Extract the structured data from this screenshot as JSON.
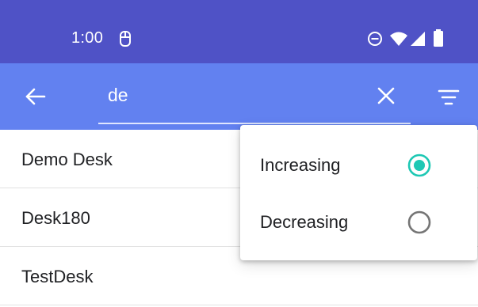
{
  "status_bar": {
    "time": "1:00",
    "icons": [
      "mouse-icon",
      "do-not-disturb-icon",
      "wifi-icon",
      "signal-icon",
      "battery-icon"
    ]
  },
  "app_bar": {
    "back_icon": "arrow-left-icon",
    "search": {
      "value": "de",
      "placeholder": ""
    },
    "clear_icon": "close-icon",
    "filter_icon": "sort-filter-icon"
  },
  "list": {
    "items": [
      {
        "label": "Demo Desk"
      },
      {
        "label": "Desk180"
      },
      {
        "label": "TestDesk"
      }
    ]
  },
  "sort_menu": {
    "options": [
      {
        "label": "Increasing",
        "selected": true
      },
      {
        "label": "Decreasing",
        "selected": false
      }
    ]
  },
  "colors": {
    "status_bar": "#4f52c6",
    "app_bar": "#6281f0",
    "radio_selected": "#1ec8b4",
    "radio_unselected": "#757575"
  }
}
